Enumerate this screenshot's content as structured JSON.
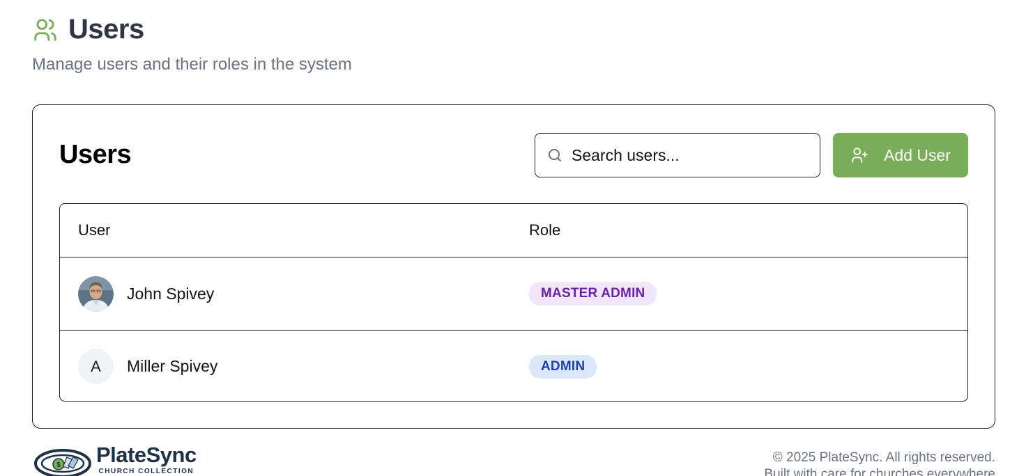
{
  "header": {
    "title": "Users",
    "subtitle": "Manage users and their roles in the system",
    "icon": "users-icon",
    "accent_color": "#7aad5a"
  },
  "card": {
    "title": "Users",
    "search": {
      "placeholder": "Search users...",
      "value": ""
    },
    "add_button": {
      "label": "Add User",
      "icon": "user-plus-icon",
      "color": "#7aad5a"
    }
  },
  "table": {
    "columns": [
      "User",
      "Role"
    ],
    "rows": [
      {
        "name": "John Spivey",
        "avatar": "photo",
        "role": "MASTER ADMIN",
        "role_bg": "#f2e6fb",
        "role_fg": "#6b21a8"
      },
      {
        "name": "Miller Spivey",
        "avatar_initial": "A",
        "role": "ADMIN",
        "role_bg": "#dbe8fb",
        "role_fg": "#1e40af"
      }
    ]
  },
  "footer": {
    "brand_name": "PlateSync",
    "brand_tagline": "CHURCH COLLECTION",
    "copyright": "© 2025 PlateSync. All rights reserved.",
    "tagline": "Built with care for churches everywhere"
  }
}
